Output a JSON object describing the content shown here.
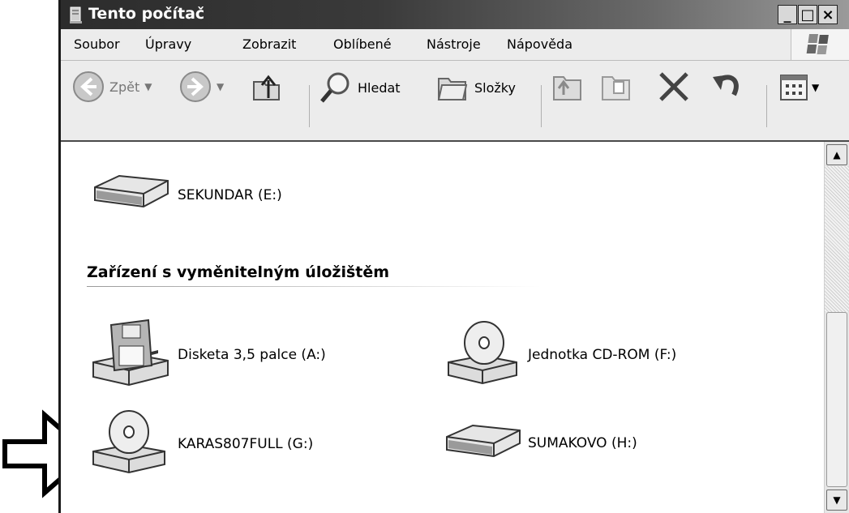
{
  "window": {
    "title": "Tento počítač",
    "buttons": {
      "minimize": "_",
      "maximize": "□",
      "close": "×"
    }
  },
  "menu": {
    "items": [
      "Soubor",
      "Úpravy",
      "Zobrazit",
      "Oblíbené",
      "Nástroje",
      "Nápověda"
    ]
  },
  "toolbar": {
    "back_label": "Zpět",
    "search_label": "Hledat",
    "folders_label": "Složky",
    "icons": [
      "back-arrow-icon",
      "forward-arrow-icon",
      "up-folder-icon",
      "magnifier-icon",
      "folders-icon",
      "move-to-icon",
      "copy-to-icon",
      "delete-x-icon",
      "undo-icon",
      "views-icon"
    ]
  },
  "content": {
    "drives_top": [
      {
        "label": "SEKUNDAR (E:)",
        "icon": "hard-drive-icon"
      }
    ],
    "removable_group": {
      "heading": "Zařízení s vyměnitelným úložištěm",
      "items": [
        {
          "label": "Disketa 3,5 palce (A:)",
          "icon": "floppy-drive-icon"
        },
        {
          "label": "Jednotka CD-ROM (F:)",
          "icon": "cd-drive-icon"
        },
        {
          "label": "KARAS807FULL (G:)",
          "icon": "cd-drive-icon"
        },
        {
          "label": "SUMAKOVO (H:)",
          "icon": "removable-disk-icon"
        }
      ]
    }
  },
  "scrollbar": {
    "up": "▲",
    "down": "▼"
  },
  "annotation": {
    "icon": "right-arrow-outline-icon"
  }
}
